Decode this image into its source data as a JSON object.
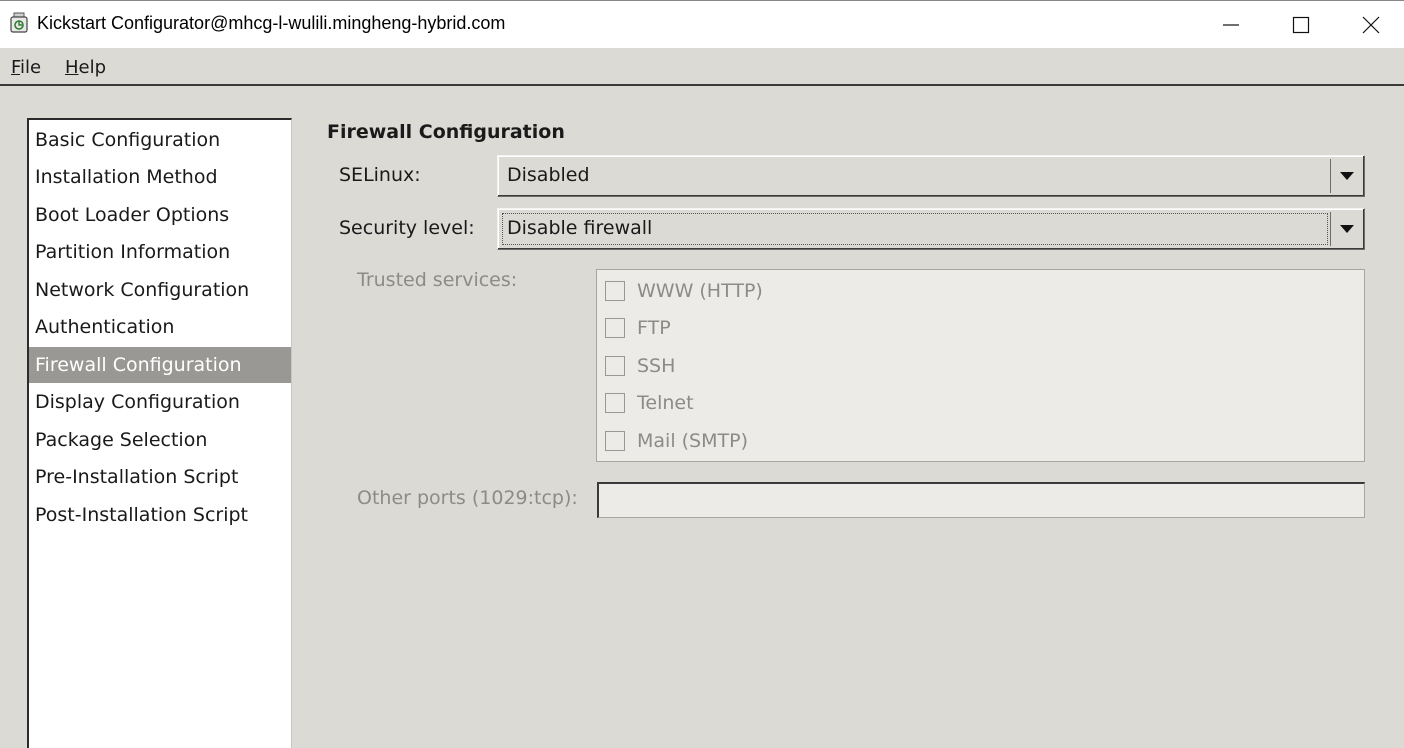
{
  "window": {
    "title": "Kickstart Configurator@mhcg-l-wulili.mingheng-hybrid.com",
    "icon": "kickstart-app-icon"
  },
  "menu": {
    "file_prefix": "F",
    "file_rest": "ile",
    "help_prefix": "H",
    "help_rest": "elp"
  },
  "sidebar": {
    "selected_index": 6,
    "items": [
      {
        "label": "Basic Configuration"
      },
      {
        "label": "Installation Method"
      },
      {
        "label": "Boot Loader Options"
      },
      {
        "label": "Partition Information"
      },
      {
        "label": "Network Configuration"
      },
      {
        "label": "Authentication"
      },
      {
        "label": "Firewall Configuration"
      },
      {
        "label": "Display Configuration"
      },
      {
        "label": "Package Selection"
      },
      {
        "label": "Pre-Installation Script"
      },
      {
        "label": "Post-Installation Script"
      }
    ]
  },
  "main": {
    "title": "Firewall Configuration",
    "selinux_label": "SELinux:",
    "selinux_value": "Disabled",
    "security_label": "Security level:",
    "security_value": "Disable firewall",
    "trusted_label": "Trusted services:",
    "services": [
      {
        "label": "WWW (HTTP)",
        "checked": false
      },
      {
        "label": "FTP",
        "checked": false
      },
      {
        "label": "SSH",
        "checked": false
      },
      {
        "label": "Telnet",
        "checked": false
      },
      {
        "label": "Mail (SMTP)",
        "checked": false
      }
    ],
    "other_ports_label": "Other ports (1029:tcp):",
    "other_ports_value": ""
  },
  "colors": {
    "background": "#dcdad5",
    "selection": "#9a9894",
    "disabled_text": "#8d8b87"
  }
}
